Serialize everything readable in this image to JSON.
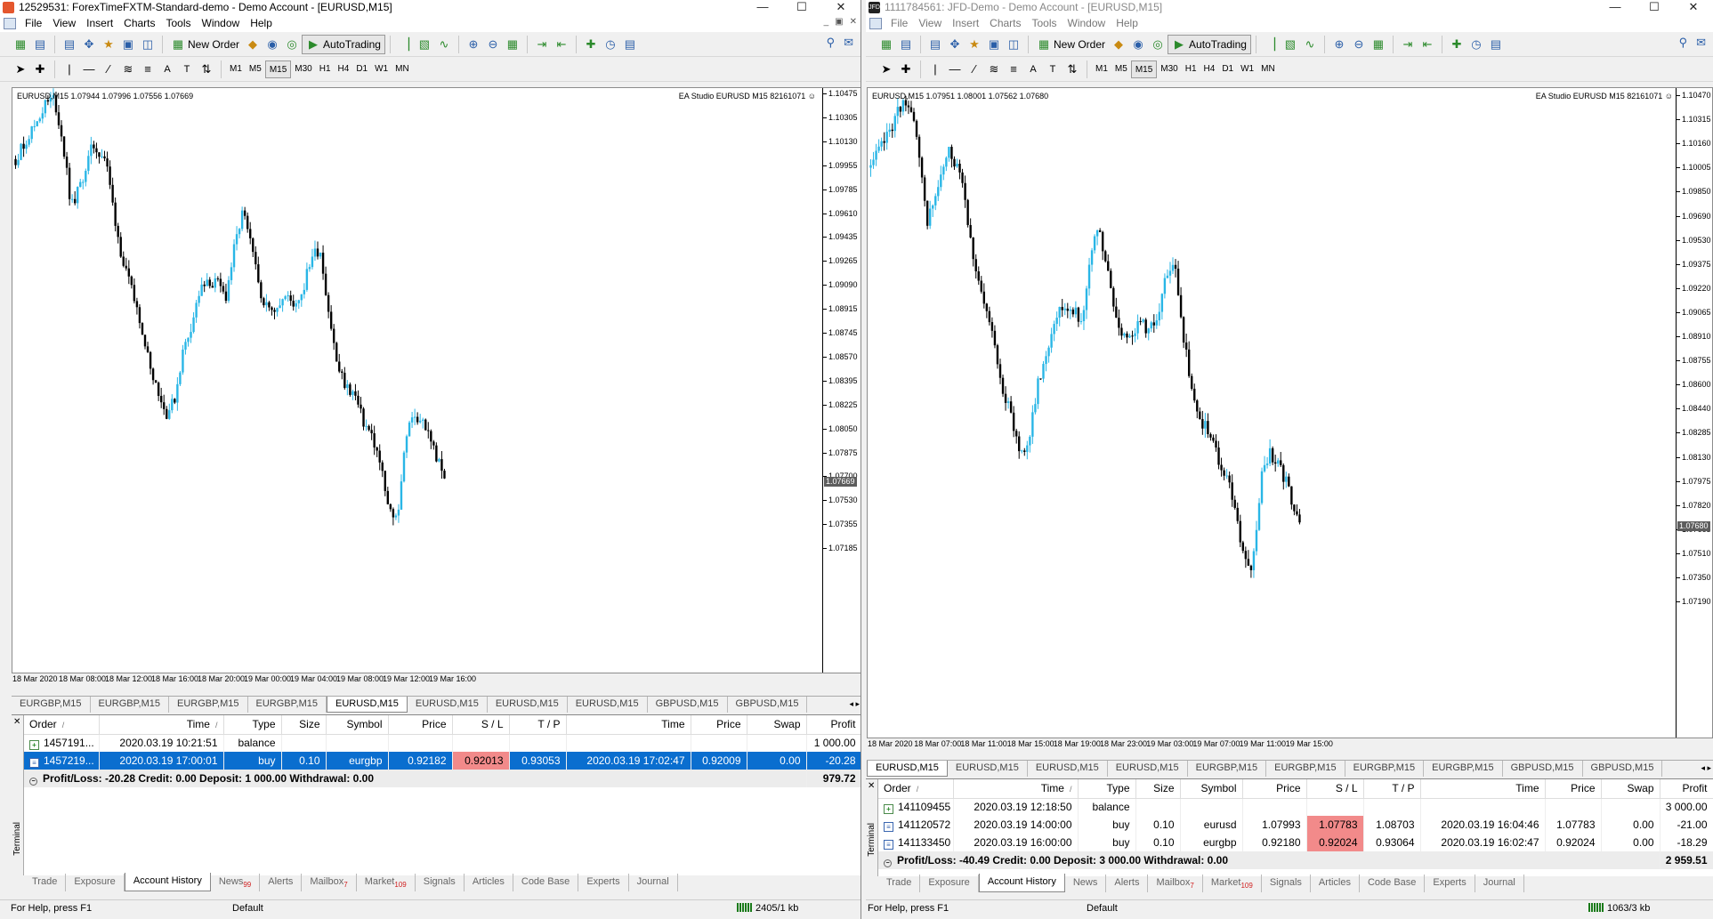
{
  "window1": {
    "title": "12529531: ForexTimeFXTM-Standard-demo - Demo Account - [EURUSD,M15]",
    "menu": [
      "File",
      "View",
      "Insert",
      "Charts",
      "Tools",
      "Window",
      "Help"
    ],
    "toolbar": {
      "new_order": "New Order",
      "autotrading": "AutoTrading"
    },
    "timeframes": [
      "M1",
      "M5",
      "M15",
      "M30",
      "H1",
      "H4",
      "D1",
      "W1",
      "MN"
    ],
    "active_timeframe": "M15",
    "chart": {
      "info": "EURUSD,M15  1.07944 1.07996 1.07556 1.07669",
      "ea_label": "EA Studio EURUSD M15 82161071 ☺",
      "current_price": "1.07669",
      "y_labels": [
        "1.10475",
        "1.10305",
        "1.10130",
        "1.09955",
        "1.09785",
        "1.09610",
        "1.09435",
        "1.09265",
        "1.09090",
        "1.08915",
        "1.08745",
        "1.08570",
        "1.08395",
        "1.08225",
        "1.08050",
        "1.07875",
        "1.07700",
        "1.07530",
        "1.07355",
        "1.07185"
      ],
      "x_labels": [
        "18 Mar 2020",
        "18 Mar 08:00",
        "18 Mar 12:00",
        "18 Mar 16:00",
        "18 Mar 20:00",
        "19 Mar 00:00",
        "19 Mar 04:00",
        "19 Mar 08:00",
        "19 Mar 12:00",
        "19 Mar 16:00"
      ]
    },
    "chart_tabs": [
      "EURGBP,M15",
      "EURGBP,M15",
      "EURGBP,M15",
      "EURGBP,M15",
      "EURUSD,M15",
      "EURUSD,M15",
      "EURUSD,M15",
      "EURUSD,M15",
      "GBPUSD,M15",
      "GBPUSD,M15"
    ],
    "active_chart_tab": 4,
    "columns": [
      "Order",
      "Time",
      "Type",
      "Size",
      "Symbol",
      "Price",
      "S / L",
      "T / P",
      "Time",
      "Price",
      "Swap",
      "Profit"
    ],
    "rows": [
      {
        "order": "1457191...",
        "time": "2020.03.19 10:21:51",
        "type": "balance",
        "size": "",
        "symbol": "",
        "price": "",
        "sl": "",
        "tp": "",
        "ctime": "",
        "cprice": "",
        "swap": "",
        "profit": "1 000.00",
        "icon": "deposit",
        "selected": false
      },
      {
        "order": "1457219...",
        "time": "2020.03.19 17:00:01",
        "type": "buy",
        "size": "0.10",
        "symbol": "eurgbp",
        "price": "0.92182",
        "sl": "0.92013",
        "tp": "0.93053",
        "ctime": "2020.03.19 17:02:47",
        "cprice": "0.92009",
        "swap": "0.00",
        "profit": "-20.28",
        "icon": "doc",
        "selected": true
      }
    ],
    "summary": "Profit/Loss: -20.28  Credit: 0.00  Deposit: 1 000.00  Withdrawal: 0.00",
    "summary_total": "979.72",
    "terminal_label": "Terminal",
    "terminal_tabs": [
      {
        "label": "Trade",
        "badge": ""
      },
      {
        "label": "Exposure",
        "badge": ""
      },
      {
        "label": "Account History",
        "badge": ""
      },
      {
        "label": "News",
        "badge": "99"
      },
      {
        "label": "Alerts",
        "badge": ""
      },
      {
        "label": "Mailbox",
        "badge": "7"
      },
      {
        "label": "Market",
        "badge": "109"
      },
      {
        "label": "Signals",
        "badge": ""
      },
      {
        "label": "Articles",
        "badge": ""
      },
      {
        "label": "Code Base",
        "badge": ""
      },
      {
        "label": "Experts",
        "badge": ""
      },
      {
        "label": "Journal",
        "badge": ""
      }
    ],
    "active_terminal_tab": 2,
    "status": {
      "help": "For Help, press F1",
      "profile": "Default",
      "traffic": "2405/1 kb"
    }
  },
  "window2": {
    "title": "1111784561: JFD-Demo - Demo Account - [EURUSD,M15]",
    "menu": [
      "File",
      "View",
      "Insert",
      "Charts",
      "Tools",
      "Window",
      "Help"
    ],
    "toolbar": {
      "new_order": "New Order",
      "autotrading": "AutoTrading"
    },
    "timeframes": [
      "M1",
      "M5",
      "M15",
      "M30",
      "H1",
      "H4",
      "D1",
      "W1",
      "MN"
    ],
    "active_timeframe": "M15",
    "chart": {
      "info": "EURUSD,M15  1.07951 1.08001 1.07562 1.07680",
      "ea_label": "EA Studio EURUSD M15 82161071 ☺",
      "current_price": "1.07680",
      "y_labels": [
        "1.10470",
        "1.10315",
        "1.10160",
        "1.10005",
        "1.09850",
        "1.09690",
        "1.09530",
        "1.09375",
        "1.09220",
        "1.09065",
        "1.08910",
        "1.08755",
        "1.08600",
        "1.08440",
        "1.08285",
        "1.08130",
        "1.07975",
        "1.07820",
        "1.07665",
        "1.07510",
        "1.07350",
        "1.07190"
      ],
      "x_labels": [
        "18 Mar 2020",
        "18 Mar 07:00",
        "18 Mar 11:00",
        "18 Mar 15:00",
        "18 Mar 19:00",
        "18 Mar 23:00",
        "19 Mar 03:00",
        "19 Mar 07:00",
        "19 Mar 11:00",
        "19 Mar 15:00"
      ]
    },
    "chart_tabs": [
      "EURUSD,M15",
      "EURUSD,M15",
      "EURUSD,M15",
      "EURUSD,M15",
      "EURGBP,M15",
      "EURGBP,M15",
      "EURGBP,M15",
      "EURGBP,M15",
      "GBPUSD,M15",
      "GBPUSD,M15"
    ],
    "active_chart_tab": 0,
    "columns": [
      "Order",
      "Time",
      "Type",
      "Size",
      "Symbol",
      "Price",
      "S / L",
      "T / P",
      "Time",
      "Price",
      "Swap",
      "Profit"
    ],
    "rows": [
      {
        "order": "141109455",
        "time": "2020.03.19 12:18:50",
        "type": "balance",
        "size": "",
        "symbol": "",
        "price": "",
        "sl": "",
        "tp": "",
        "ctime": "",
        "cprice": "",
        "swap": "",
        "profit": "3 000.00",
        "icon": "deposit",
        "selected": false
      },
      {
        "order": "141120572",
        "time": "2020.03.19 14:00:00",
        "type": "buy",
        "size": "0.10",
        "symbol": "eurusd",
        "price": "1.07993",
        "sl": "1.07783",
        "tp": "1.08703",
        "ctime": "2020.03.19 16:04:46",
        "cprice": "1.07783",
        "swap": "0.00",
        "profit": "-21.00",
        "icon": "doc",
        "selected": false
      },
      {
        "order": "141133450",
        "time": "2020.03.19 16:00:00",
        "type": "buy",
        "size": "0.10",
        "symbol": "eurgbp",
        "price": "0.92180",
        "sl": "0.92024",
        "tp": "0.93064",
        "ctime": "2020.03.19 16:02:47",
        "cprice": "0.92024",
        "swap": "0.00",
        "profit": "-18.29",
        "icon": "doc",
        "selected": false
      }
    ],
    "summary": "Profit/Loss: -40.49  Credit: 0.00  Deposit: 3 000.00  Withdrawal: 0.00",
    "summary_total": "2 959.51",
    "terminal_label": "Terminal",
    "terminal_tabs": [
      {
        "label": "Trade",
        "badge": ""
      },
      {
        "label": "Exposure",
        "badge": ""
      },
      {
        "label": "Account History",
        "badge": ""
      },
      {
        "label": "News",
        "badge": ""
      },
      {
        "label": "Alerts",
        "badge": ""
      },
      {
        "label": "Mailbox",
        "badge": "7"
      },
      {
        "label": "Market",
        "badge": "109"
      },
      {
        "label": "Signals",
        "badge": ""
      },
      {
        "label": "Articles",
        "badge": ""
      },
      {
        "label": "Code Base",
        "badge": ""
      },
      {
        "label": "Experts",
        "badge": ""
      },
      {
        "label": "Journal",
        "badge": ""
      }
    ],
    "active_terminal_tab": 2,
    "status": {
      "help": "For Help, press F1",
      "profile": "Default",
      "traffic": "1063/3 kb"
    }
  },
  "chart_data": [
    {
      "type": "candlestick",
      "title": "EURUSD,M15",
      "x_range": [
        "18 Mar 2020",
        "19 Mar 16:00"
      ],
      "ylim": [
        1.07185,
        1.10475
      ],
      "last": 1.07669,
      "x": [
        0,
        0.04,
        0.07,
        0.09,
        0.11,
        0.13,
        0.15,
        0.18,
        0.21,
        0.23,
        0.25,
        0.27,
        0.29,
        0.31,
        0.33,
        0.35,
        0.37,
        0.39,
        0.41,
        0.43,
        0.45,
        0.47,
        0.49,
        0.51,
        0.53,
        0.55,
        0.57,
        0.59,
        0.61,
        0.63,
        0.65,
        0.67,
        0.69,
        0.71,
        0.73,
        0.75,
        0.77,
        0.79,
        0.81,
        0.83,
        0.85,
        0.87,
        0.89,
        0.91,
        0.93,
        0.95,
        0.97,
        1
      ],
      "y": [
        1.1,
        1.1022,
        1.104,
        1.1044,
        1.1012,
        1.0965,
        1.098,
        1.101,
        1.1,
        1.096,
        1.0925,
        1.0905,
        1.0885,
        1.0855,
        1.0835,
        1.0815,
        1.0825,
        1.086,
        1.088,
        1.0905,
        1.091,
        1.091,
        1.09,
        1.0935,
        1.0962,
        1.0935,
        1.0905,
        1.089,
        1.0895,
        1.09,
        1.0895,
        1.0905,
        1.093,
        1.0935,
        1.089,
        1.085,
        1.0835,
        1.083,
        1.081,
        1.08,
        1.078,
        1.0745,
        1.074,
        1.08,
        1.0815,
        1.081,
        1.0795,
        1.0767
      ]
    },
    {
      "type": "candlestick",
      "title": "EURUSD,M15",
      "x_range": [
        "18 Mar 2020",
        "19 Mar 15:00"
      ],
      "ylim": [
        1.0719,
        1.1047
      ],
      "last": 1.0768,
      "x": [
        0,
        0.04,
        0.07,
        0.09,
        0.11,
        0.13,
        0.15,
        0.18,
        0.21,
        0.23,
        0.25,
        0.27,
        0.29,
        0.31,
        0.33,
        0.35,
        0.37,
        0.39,
        0.41,
        0.43,
        0.45,
        0.47,
        0.49,
        0.51,
        0.53,
        0.55,
        0.57,
        0.59,
        0.61,
        0.63,
        0.65,
        0.67,
        0.69,
        0.71,
        0.73,
        0.75,
        0.77,
        0.79,
        0.81,
        0.83,
        0.85,
        0.87,
        0.89,
        0.91,
        0.93,
        0.95,
        0.97,
        1
      ],
      "y": [
        1.1,
        1.1022,
        1.104,
        1.1044,
        1.1012,
        1.0965,
        1.098,
        1.101,
        1.1,
        1.096,
        1.0925,
        1.0905,
        1.0885,
        1.0855,
        1.0835,
        1.0815,
        1.0825,
        1.086,
        1.088,
        1.0905,
        1.091,
        1.091,
        1.09,
        1.0935,
        1.0962,
        1.0935,
        1.0905,
        1.089,
        1.0895,
        1.09,
        1.0895,
        1.0905,
        1.093,
        1.0935,
        1.089,
        1.085,
        1.0835,
        1.083,
        1.081,
        1.08,
        1.078,
        1.0745,
        1.074,
        1.08,
        1.0815,
        1.081,
        1.0795,
        1.0768
      ]
    }
  ]
}
